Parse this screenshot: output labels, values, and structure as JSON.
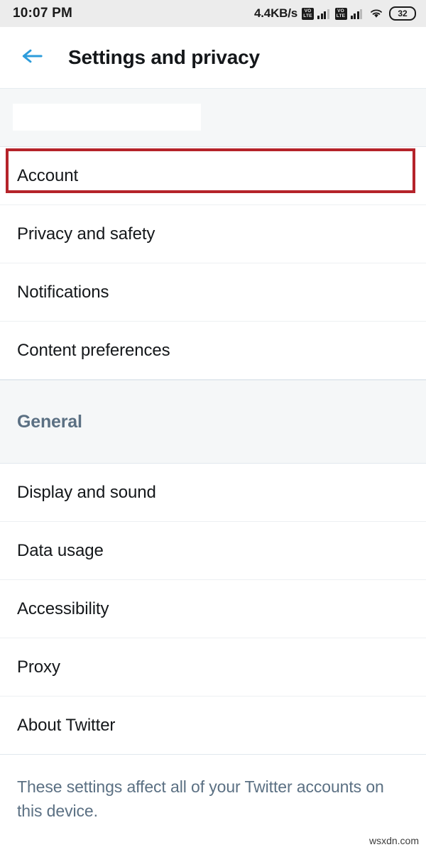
{
  "status_bar": {
    "clock": "10:07 PM",
    "network_speed": "4.4KB/s",
    "volte_top": "VO",
    "volte_bottom": "LTE",
    "battery_level": "32",
    "icons": [
      "volte-icon",
      "signal-bars-icon",
      "volte-icon",
      "signal-bars-icon",
      "wifi-icon",
      "battery-icon"
    ]
  },
  "app_bar": {
    "back_icon": "back-arrow-icon",
    "title": "Settings and privacy",
    "accent_color": "#2d9cdb"
  },
  "sections": [
    {
      "header": "",
      "redacted": true,
      "items": [
        {
          "label": "Account",
          "highlighted": true
        },
        {
          "label": "Privacy and safety",
          "highlighted": false
        },
        {
          "label": "Notifications",
          "highlighted": false
        },
        {
          "label": "Content preferences",
          "highlighted": false
        }
      ]
    },
    {
      "header": "General",
      "redacted": false,
      "items": [
        {
          "label": "Display and sound",
          "highlighted": false
        },
        {
          "label": "Data usage",
          "highlighted": false
        },
        {
          "label": "Accessibility",
          "highlighted": false
        },
        {
          "label": "Proxy",
          "highlighted": false
        },
        {
          "label": "About Twitter",
          "highlighted": false
        }
      ]
    }
  ],
  "footer": {
    "text": "These settings affect all of your Twitter accounts on this device."
  },
  "watermark": {
    "text": "wsxdn.com"
  },
  "annotation": {
    "target": "Account",
    "color": "#b5232a"
  }
}
